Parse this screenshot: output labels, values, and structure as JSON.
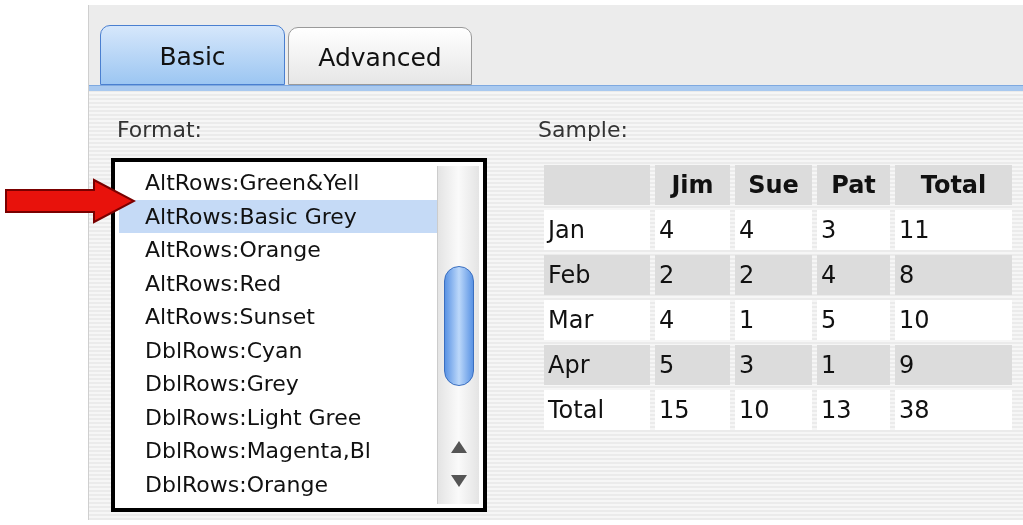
{
  "tabs": [
    {
      "label": "Basic",
      "selected": true
    },
    {
      "label": "Advanced",
      "selected": false
    }
  ],
  "format": {
    "label": "Format:",
    "items": [
      {
        "label": "AltRows:Green&Yell",
        "selected": false
      },
      {
        "label": "AltRows:Basic Grey",
        "selected": true
      },
      {
        "label": "AltRows:Orange",
        "selected": false
      },
      {
        "label": "AltRows:Red",
        "selected": false
      },
      {
        "label": "AltRows:Sunset",
        "selected": false
      },
      {
        "label": "DblRows:Cyan",
        "selected": false
      },
      {
        "label": "DblRows:Grey",
        "selected": false
      },
      {
        "label": "DblRows:Light Gree",
        "selected": false
      },
      {
        "label": "DblRows:Magenta,Bl",
        "selected": false
      },
      {
        "label": "DblRows:Orange",
        "selected": false
      }
    ]
  },
  "sample": {
    "label": "Sample:",
    "columns": [
      "Jim",
      "Sue",
      "Pat",
      "Total"
    ],
    "rows": [
      {
        "label": "Jan",
        "cells": [
          "4",
          "4",
          "3",
          "11"
        ]
      },
      {
        "label": "Feb",
        "cells": [
          "2",
          "2",
          "4",
          "8"
        ]
      },
      {
        "label": "Mar",
        "cells": [
          "4",
          "1",
          "5",
          "10"
        ]
      },
      {
        "label": "Apr",
        "cells": [
          "5",
          "3",
          "1",
          "9"
        ]
      },
      {
        "label": "Total",
        "cells": [
          "15",
          "10",
          "13",
          "38"
        ]
      }
    ]
  }
}
